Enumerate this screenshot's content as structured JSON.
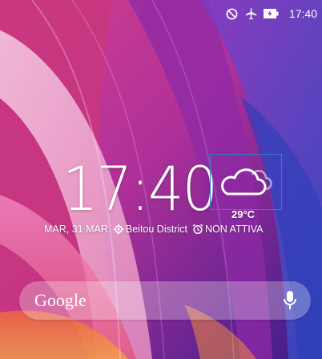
{
  "status_bar": {
    "icons": [
      "do-not-disturb-icon",
      "airplane-mode-icon",
      "battery-charging-icon"
    ],
    "time": "17:40"
  },
  "lock_clock": {
    "time": "17:40",
    "weather": {
      "icon": "cloudy-icon",
      "temperature": "29°C"
    },
    "date": "MAR, 31 MAR",
    "location": "Beitou District",
    "alarm": "NON ATTIVA"
  },
  "search": {
    "label": "Google",
    "mic_icon": "microphone-icon"
  }
}
